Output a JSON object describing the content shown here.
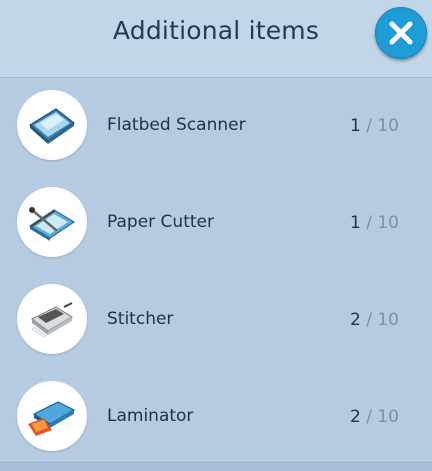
{
  "header": {
    "title": "Additional items",
    "close_icon": "close-x-icon"
  },
  "items": [
    {
      "label": "Flatbed Scanner",
      "count": "1",
      "sep": "/",
      "max": "10",
      "icon": "flatbed-scanner-icon"
    },
    {
      "label": "Paper Cutter",
      "count": "1",
      "sep": "/",
      "max": "10",
      "icon": "paper-cutter-icon"
    },
    {
      "label": "Stitcher",
      "count": "2",
      "sep": "/",
      "max": "10",
      "icon": "stitcher-icon"
    },
    {
      "label": "Laminator",
      "count": "2",
      "sep": "/",
      "max": "10",
      "icon": "laminator-icon"
    }
  ],
  "colors": {
    "accent": "#1f9bd6",
    "panel": "#b5cbe2",
    "header": "#c2d6ea",
    "text": "#1f3247"
  }
}
